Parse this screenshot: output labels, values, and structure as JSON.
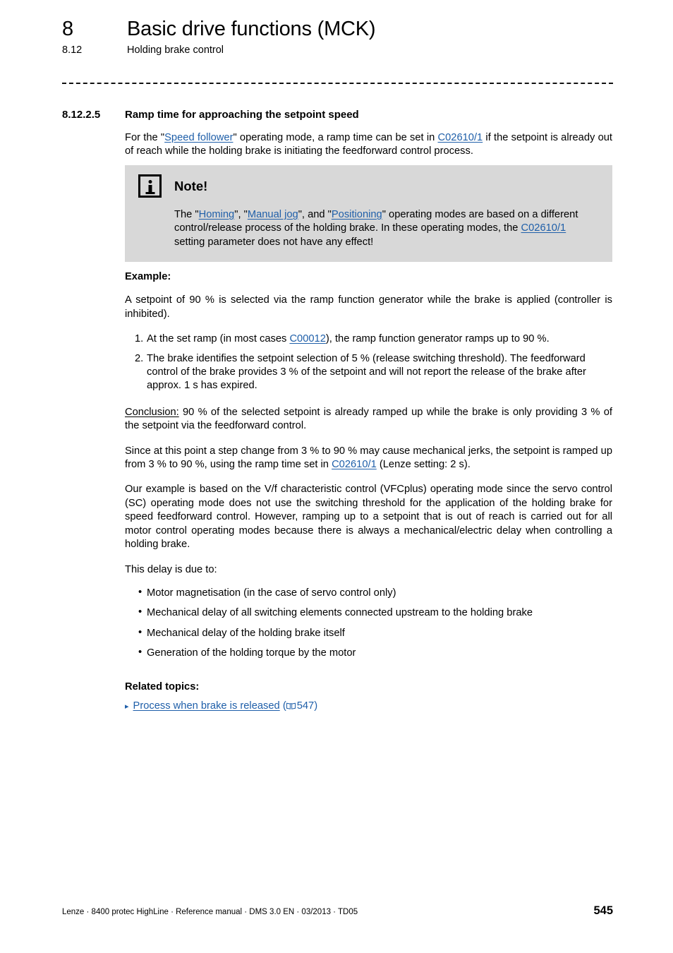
{
  "header": {
    "chapter_number": "8",
    "chapter_title": "Basic drive functions (MCK)",
    "section_number": "8.12",
    "section_title": "Holding brake control"
  },
  "section": {
    "number": "8.12.2.5",
    "title": "Ramp time for approaching the setpoint speed"
  },
  "intro": {
    "t1": "For the \"",
    "link_speed_follower": "Speed follower",
    "t2": "\" operating mode, a ramp time can be set in ",
    "link_c02610_1": "C02610/1",
    "t3": " if the setpoint is already out of reach while the holding brake is initiating the feedforward control process."
  },
  "note": {
    "icon": "info-icon",
    "title": "Note!",
    "t1": "The \"",
    "link_homing": "Homing",
    "t2": "\", \"",
    "link_manual_jog": "Manual jog",
    "t3": "\", and \"",
    "link_positioning": "Positioning",
    "t4": "\" operating modes are based on a different control/release process of the holding brake. In these operating modes, the ",
    "link_c02610_1": "C02610/1",
    "t5": " setting parameter does not have any effect!",
    "background": "#d8d8d8"
  },
  "example": {
    "heading": "Example:",
    "intro": "A setpoint of 90 % is selected via the ramp function generator while the brake is applied (controller is inhibited).",
    "steps": [
      {
        "marker": "1.",
        "t1": "At the set ramp (in most cases ",
        "link": "C00012",
        "t2": "), the ramp function generator ramps up to 90 %."
      },
      {
        "marker": "2.",
        "t1": "The brake identifies the setpoint selection of 5 % (release switching threshold). The feedforward control of the brake provides 3 % of the setpoint and will not report the release of the brake after approx. 1 s has expired.",
        "link": "",
        "t2": ""
      }
    ]
  },
  "conclusion": {
    "label": "Conclusion:",
    "text": " 90 % of the selected setpoint is already ramped up while the brake is only providing 3 % of the setpoint via the feedforward control."
  },
  "ramp_para": {
    "t1": "Since at this point a step change from 3 % to 90 % may cause mechanical jerks, the setpoint is ramped up from 3 % to 90 %, using the ramp time set in ",
    "link_c02610_1": "C02610/1",
    "t2": " (Lenze setting: 2 s)."
  },
  "vf_para": {
    "text": "Our example is based on the V/f characteristic control (VFCplus) operating mode since the servo control (SC) operating mode does not use the switching threshold for the application of the holding brake for speed feedforward control. However, ramping up to a setpoint that is out of reach is carried out for all motor control operating modes because there is always a mechanical/electric delay when controlling a holding brake."
  },
  "delay": {
    "lead_in": "This delay is due to:",
    "bullet_marker": "•",
    "items": [
      "Motor magnetisation (in the case of servo control only)",
      "Mechanical delay of all switching elements connected upstream to the holding brake",
      "Mechanical delay of the holding brake itself",
      "Generation of the holding torque by the motor"
    ]
  },
  "related": {
    "heading": "Related topics:",
    "triangle_marker": "▸",
    "link": "Process when brake is released",
    "page_ref_open": "(",
    "page_ref_number": "547",
    "page_ref_close": ")"
  },
  "footer": {
    "text": "Lenze · 8400 protec HighLine · Reference manual · DMS 3.0 EN · 03/2013 · TD05",
    "page_number": "545"
  },
  "colors": {
    "link": "#1f5fa9",
    "note_background": "#d8d8d8",
    "text": "#000000"
  }
}
